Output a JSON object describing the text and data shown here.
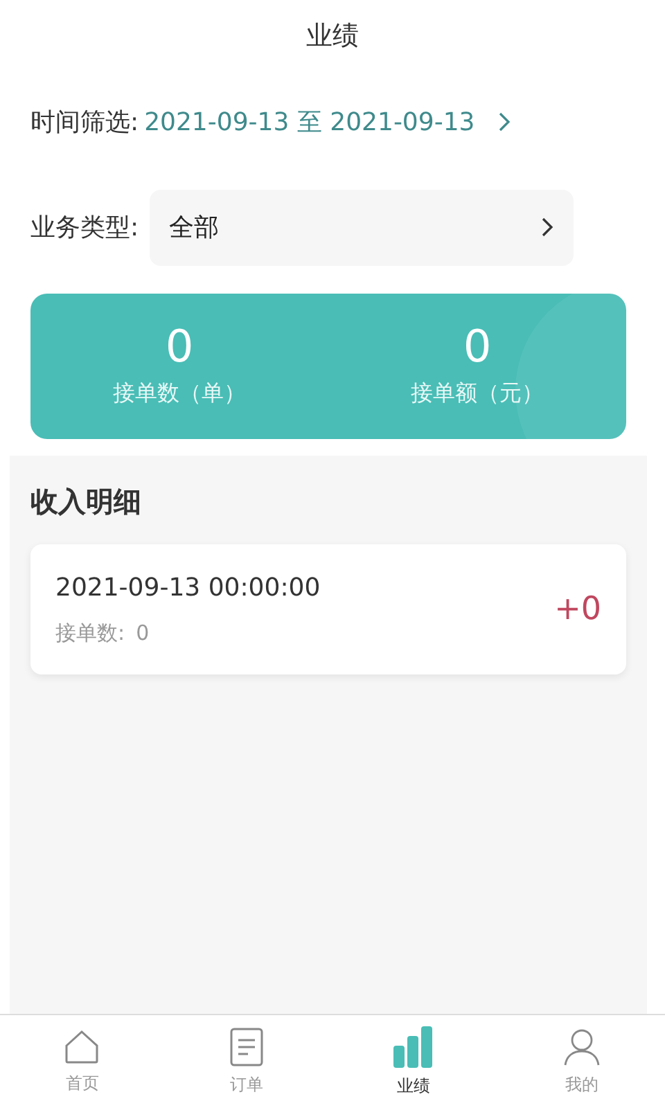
{
  "header": {
    "title": "业绩"
  },
  "time_filter": {
    "label": "时间筛选:",
    "value": "2021-09-13 至 2021-09-13"
  },
  "business_type": {
    "label": "业务类型:",
    "value": "全部"
  },
  "summary": [
    {
      "value": "0",
      "label": "接单数（单）"
    },
    {
      "value": "0",
      "label": "接单额（元）"
    }
  ],
  "income_detail": {
    "title": "收入明细",
    "records": [
      {
        "datetime": "2021-09-13 00:00:00",
        "count_label": "接单数:",
        "count": "0",
        "amount": "+0"
      }
    ]
  },
  "tab_bar": [
    {
      "label": "首页",
      "selected": false
    },
    {
      "label": "订单",
      "selected": false
    },
    {
      "label": "业绩",
      "selected": true
    },
    {
      "label": "我的",
      "selected": false
    }
  ]
}
